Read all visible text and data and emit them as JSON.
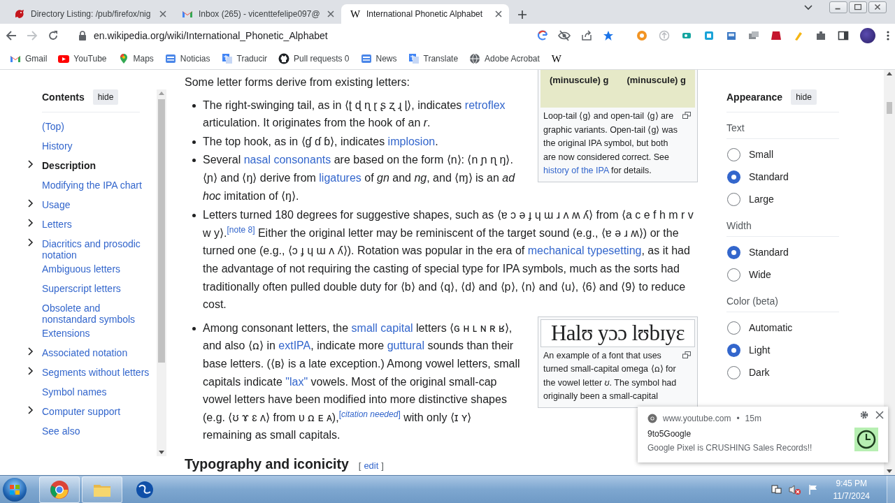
{
  "browser": {
    "tabs": [
      {
        "title": "Directory Listing: /pub/firefox/nig",
        "selected": false
      },
      {
        "title": "Inbox (265) - vicenttefelipe097@",
        "selected": false
      },
      {
        "title": "International Phonetic Alphabet",
        "glyph": "W",
        "selected": true
      }
    ],
    "url": "en.wikipedia.org/wiki/International_Phonetic_Alphabet",
    "bookmarked": true,
    "bookmarks": [
      {
        "label": "Gmail"
      },
      {
        "label": "YouTube"
      },
      {
        "label": "Maps"
      },
      {
        "label": "Noticias"
      },
      {
        "label": "Traducir"
      },
      {
        "label": "Pull requests 0"
      },
      {
        "label": "News"
      },
      {
        "label": "Translate"
      },
      {
        "label": "Adobe Acrobat"
      },
      {
        "glyph": "W"
      }
    ]
  },
  "toc": {
    "title": "Contents",
    "hide_label": "hide",
    "items": [
      {
        "label": "(Top)",
        "selected": false,
        "has_subsections": false
      },
      {
        "label": "History",
        "selected": false,
        "has_subsections": false
      },
      {
        "label": "Description",
        "selected": true,
        "has_subsections": true
      },
      {
        "label": "Modifying the IPA chart",
        "selected": false,
        "has_subsections": false
      },
      {
        "label": "Usage",
        "selected": false,
        "has_subsections": true
      },
      {
        "label": "Letters",
        "selected": false,
        "has_subsections": true
      },
      {
        "label": "Diacritics and prosodic notation",
        "selected": false,
        "has_subsections": true
      },
      {
        "label": "Ambiguous letters",
        "selected": false,
        "has_subsections": false
      },
      {
        "label": "Superscript letters",
        "selected": false,
        "has_subsections": false
      },
      {
        "label": "Obsolete and nonstandard symbols",
        "selected": false,
        "has_subsections": false
      },
      {
        "label": "Extensions",
        "selected": false,
        "has_subsections": false
      },
      {
        "label": "Associated notation",
        "selected": false,
        "has_subsections": true
      },
      {
        "label": "Segments without letters",
        "selected": false,
        "has_subsections": true
      },
      {
        "label": "Symbol names",
        "selected": false,
        "has_subsections": false
      },
      {
        "label": "Computer support",
        "selected": false,
        "has_subsections": true
      },
      {
        "label": "See also",
        "selected": false,
        "has_subsections": false
      }
    ]
  },
  "article": {
    "blocks": [
      {
        "kind": "figure_row",
        "content": [
          {
            "kind": "paragraph",
            "runs": [
              {
                "text": "Some letter forms derive from existing letters:"
              }
            ]
          },
          {
            "kind": "list",
            "items": [
              [
                {
                  "text": "The right-swinging tail, as in ⟨ʈ ɖ ɳ ɽ ʂ ʐ ɻ ɭ⟩, indicates "
                },
                {
                  "link": "retroflex"
                },
                {
                  "text": " articulation. It originates from the hook of an *r*."
                }
              ],
              [
                {
                  "text": "The top hook, as in ⟨ɠ ɗ ɓ⟩, indicates "
                },
                {
                  "link": "implosion"
                },
                {
                  "text": "."
                }
              ],
              [
                {
                  "text": "Several "
                },
                {
                  "link": "nasal consonants"
                },
                {
                  "text": " are based on the form ⟨n⟩: ⟨n ɲ ɳ ŋ⟩. ⟨ɲ⟩ and ⟨ŋ⟩ derive from "
                },
                {
                  "link": "ligatures"
                },
                {
                  "text": " of *gn* and *ng*, and ⟨ɱ⟩ is an *ad hoc* imitation of ⟨ŋ⟩."
                }
              ]
            ]
          }
        ],
        "figure": {
          "kind": "glyph_figure",
          "labels": [
            "(minuscule) g",
            "(minuscule) g"
          ],
          "caption": [
            {
              "text": "Loop-tail ⟨ɡ⟩ and open-tail ⟨g⟩ are graphic variants. Open-tail ⟨ɡ⟩ was the original IPA symbol, but both are now considered correct. See "
            },
            {
              "link": "history of the IPA"
            },
            {
              "text": " for details."
            }
          ]
        }
      },
      {
        "kind": "list",
        "items": [
          [
            {
              "text": "Letters turned 180 degrees for suggestive shapes, such as ⟨ɐ ɔ ə ɟ ɥ ɯ ɹ ʌ ʍ ʎ⟩ from ⟨a c e f h m r v w y⟩."
            },
            {
              "note": "[note 8]"
            },
            {
              "text": " Either the original letter may be reminiscent of the target sound (e.g., ⟨ɐ ə ɹ ʍ⟩) or the turned one (e.g., ⟨ɔ ɟ ɥ ɯ ʌ ʎ⟩). Rotation was popular in the era of "
            },
            {
              "link": "mechanical typesetting"
            },
            {
              "text": ", as it had the advantage of not requiring the casting of special type for IPA symbols, much as the sorts had traditionally often pulled double duty for ⟨b⟩ and ⟨q⟩, ⟨d⟩ and ⟨p⟩, ⟨n⟩ and ⟨u⟩, ⟨6⟩ and ⟨9⟩ to reduce cost."
            }
          ]
        ]
      },
      {
        "kind": "figure_row",
        "content": [
          {
            "kind": "list",
            "items": [
              [
                {
                  "text": "Among consonant letters, the "
                },
                {
                  "link": "small capital"
                },
                {
                  "text": " letters ⟨ɢ ʜ ʟ ɴ ʀ ʁ⟩, and also ⟨ꭥ⟩ in "
                },
                {
                  "link": "extIPA"
                },
                {
                  "text": ", indicate more "
                },
                {
                  "link": "guttural"
                },
                {
                  "text": " sounds than their base letters. (⟨ʙ⟩ is a late exception.) Among vowel letters, small capitals indicate "
                },
                {
                  "link": "\"lax\""
                },
                {
                  "text": " vowels. Most of the original small-cap vowel letters have been modified into more distinctive shapes (e.g. ⟨ʊ ɤ ɛ ʌ⟩ from ᴜ ꭥ ᴇ ᴀ),"
                },
                {
                  "note": "[*citation needed*]"
                },
                {
                  "text": " with only ⟨ɪ ʏ⟩ remaining as small capitals."
                }
              ]
            ]
          }
        ],
        "figure": {
          "kind": "sample_figure",
          "sample": "Halʊ yɔɔ lʊbɪyɛ",
          "caption": [
            {
              "text": "An example of a font that uses turned small-capital omega ⟨ꭥ⟩ for the vowel letter *ʊ*. The symbol had originally been a small-capital"
            }
          ]
        }
      },
      {
        "kind": "heading",
        "text": "Typography and iconicity",
        "edit_open": "[",
        "edit_label": "edit",
        "edit_close": "]"
      }
    ]
  },
  "appearance": {
    "title": "Appearance",
    "hide_label": "hide",
    "groups": [
      {
        "label": "Text",
        "options": [
          {
            "label": "Small",
            "selected": false
          },
          {
            "label": "Standard",
            "selected": true
          },
          {
            "label": "Large",
            "selected": false
          }
        ]
      },
      {
        "label": "Width",
        "options": [
          {
            "label": "Standard",
            "selected": true
          },
          {
            "label": "Wide",
            "selected": false
          }
        ]
      },
      {
        "label": "Color (beta)",
        "options": [
          {
            "label": "Automatic",
            "selected": false
          },
          {
            "label": "Light",
            "selected": true
          },
          {
            "label": "Dark",
            "selected": false
          }
        ]
      }
    ]
  },
  "notification": {
    "source": "www.youtube.com",
    "separator": "•",
    "age": "15m",
    "title": "9to5Google",
    "message": "Google Pixel is CRUSHING Sales Records!!"
  },
  "taskbar": {
    "apps": [
      {
        "running": true
      },
      {
        "running": true
      },
      {
        "running": false
      }
    ],
    "time": "9:45 PM",
    "date": "11/7/2024"
  }
}
